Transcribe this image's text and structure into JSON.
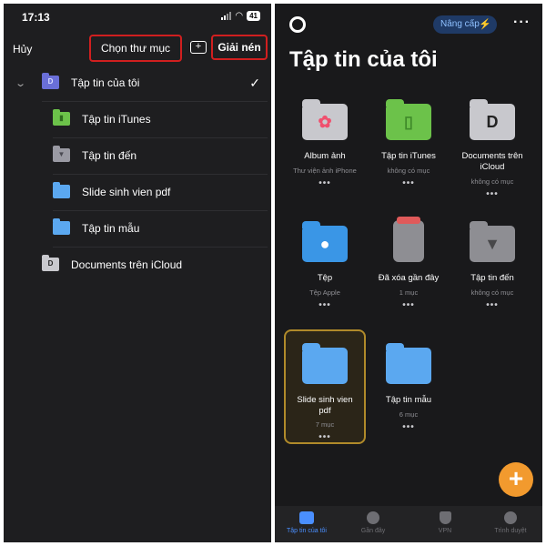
{
  "left": {
    "status_time": "17:13",
    "battery": "41",
    "cancel_label": "Hủy",
    "choose_folder_label": "Chọn thư mục",
    "extract_label": "Giải nén",
    "tree": [
      {
        "label": "Tập tin của tôi",
        "icon": "my-files-icon",
        "expanded": true,
        "checked": true
      },
      {
        "label": "Tập tin iTunes",
        "icon": "itunes-folder-icon"
      },
      {
        "label": "Tập tin đến",
        "icon": "inbox-folder-icon"
      },
      {
        "label": "Slide sinh vien pdf",
        "icon": "folder-icon"
      },
      {
        "label": "Tập tin mẫu",
        "icon": "folder-icon"
      },
      {
        "label": "Documents trên iCloud",
        "icon": "documents-icloud-icon"
      }
    ]
  },
  "right": {
    "upgrade_label": "Nâng cấp",
    "title": "Tập tin của tôi",
    "tiles": [
      {
        "label": "Album ảnh",
        "sub": "Thư viện ảnh iPhone",
        "icon": "photos-folder-icon"
      },
      {
        "label": "Tập tin iTunes",
        "sub": "không có mục",
        "icon": "itunes-folder-icon"
      },
      {
        "label": "Documents trên iCloud",
        "sub": "không có mục",
        "icon": "documents-folder-icon"
      },
      {
        "label": "Tệp",
        "sub": "Tệp Apple",
        "icon": "apple-files-folder-icon"
      },
      {
        "label": "Đã xóa gần đây",
        "sub": "1 mục",
        "icon": "trash-icon"
      },
      {
        "label": "Tập tin đến",
        "sub": "không có mục",
        "icon": "inbox-folder-icon"
      },
      {
        "label": "Slide sinh vien pdf",
        "sub": "7 mục",
        "icon": "folder-icon",
        "selected": true
      },
      {
        "label": "Tập tin mẫu",
        "sub": "6 mục",
        "icon": "folder-icon"
      }
    ],
    "tabs": [
      {
        "label": "Tập tin của tôi",
        "icon": "folder-tab-icon",
        "active": true
      },
      {
        "label": "Gần đây",
        "icon": "clock-icon"
      },
      {
        "label": "VPN",
        "icon": "shield-icon"
      },
      {
        "label": "Trình duyệt",
        "icon": "compass-icon"
      }
    ],
    "dots": "•••"
  },
  "colors": {
    "accent_red": "#d11f1f",
    "folder_blue": "#5ba8f0",
    "itunes_green": "#6cc24a",
    "fab_orange": "#f29a2e",
    "selection_gold": "#b08a2a"
  }
}
